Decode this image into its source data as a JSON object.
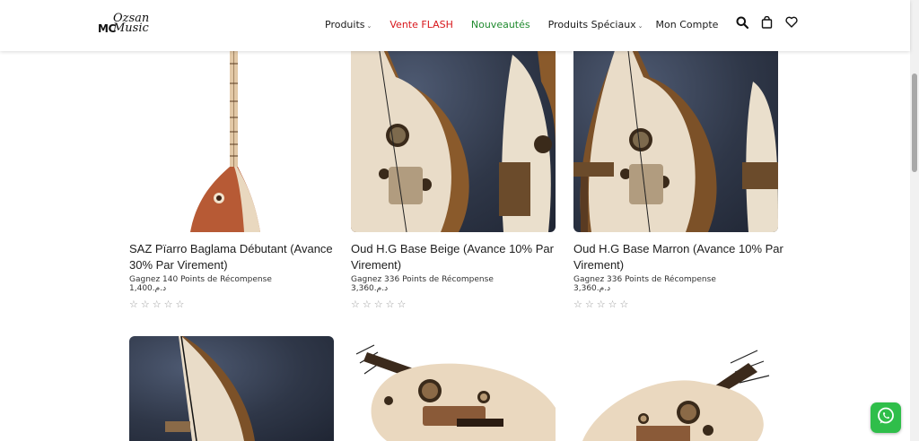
{
  "header": {
    "logo": {
      "prefix": "MC",
      "line1": "Ozsan",
      "line2": "Music"
    },
    "nav": [
      {
        "label": "Produits",
        "has_dropdown": true
      },
      {
        "label": "Vente FLASH",
        "has_dropdown": false,
        "color": "#d8161b"
      },
      {
        "label": "Nouveautés",
        "has_dropdown": false,
        "color": "#1f8a2e"
      },
      {
        "label": "Produits Spéciaux",
        "has_dropdown": true
      },
      {
        "label": "Mon Compte",
        "has_dropdown": false
      }
    ],
    "icons": [
      "search-icon",
      "shopping-bag-icon",
      "heart-icon"
    ]
  },
  "products": [
    {
      "title": "SAZ Pïarro Baglama Débutant (Avance 30% Par Virement)",
      "reward": "Gagnez 140 Points de Récompense",
      "price": "1,400.د.م",
      "rating": 0
    },
    {
      "title": "Oud H.G Base Beige (Avance 10% Par Virement)",
      "reward": "Gagnez 336 Points de Récompense",
      "price": "3,360.د.م",
      "rating": 0
    },
    {
      "title": "Oud H.G Base Marron (Avance 10% Par Virement)",
      "reward": "Gagnez 336 Points de Récompense",
      "price": "3,360.د.م",
      "rating": 0
    }
  ],
  "chevron": "⌄",
  "star": "☆",
  "colors": {
    "flash": "#d8161b",
    "new": "#1f8a2e",
    "whatsapp": "#2fbe4a"
  }
}
